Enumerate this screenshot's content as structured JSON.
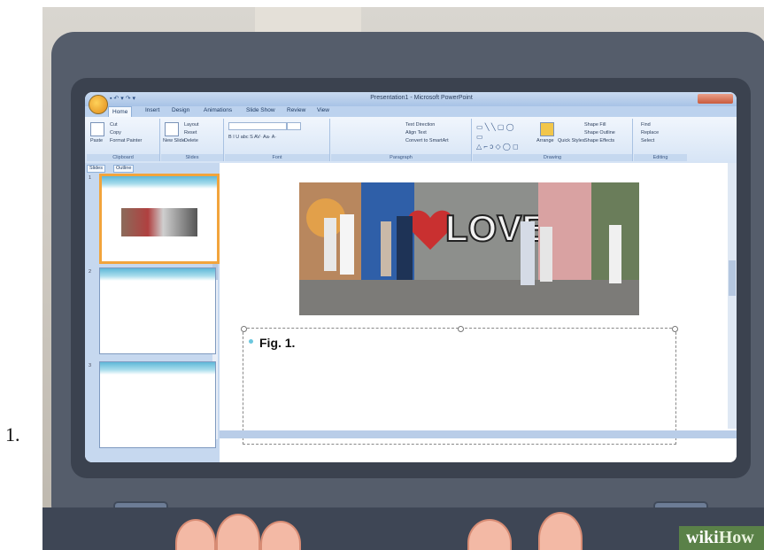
{
  "step": {
    "number": "1."
  },
  "window": {
    "title": "Presentation1 - Microsoft PowerPoint",
    "quick_access": "▪ ↶ ▾ ↷ ▾"
  },
  "ribbon_tabs": [
    "Home",
    "Insert",
    "Design",
    "Animations",
    "Slide Show",
    "Review",
    "View"
  ],
  "ribbon": {
    "clipboard": {
      "paste": "Paste",
      "cut": "Cut",
      "copy": "Copy",
      "format_painter": "Format Painter",
      "label": "Clipboard"
    },
    "slides": {
      "new_slide": "New Slide",
      "layout": "Layout",
      "reset": "Reset",
      "delete": "Delete",
      "label": "Slides"
    },
    "font": {
      "label": "Font",
      "row": "B I U abc S AV· Aa· A·"
    },
    "paragraph": {
      "text_direction": "Text Direction",
      "align_text": "Align Text",
      "smartart": "Convert to SmartArt",
      "label": "Paragraph"
    },
    "drawing": {
      "arrange": "Arrange",
      "quick_styles": "Quick Styles",
      "shape_fill": "Shape Fill",
      "shape_outline": "Shape Outline",
      "shape_effects": "Shape Effects",
      "label": "Drawing"
    },
    "editing": {
      "find": "Find",
      "replace": "Replace",
      "select": "Select",
      "label": "Editing"
    }
  },
  "panel": {
    "tabs": [
      "Slides",
      "Outline"
    ],
    "thumbnails": [
      "1",
      "2",
      "3"
    ]
  },
  "slide": {
    "caption": "Fig. 1."
  },
  "watermark": {
    "part1": "wiki",
    "part2": "How"
  },
  "colors": {
    "accent_selection": "#f2a43c",
    "ribbon_blue": "#d6e4f5",
    "title_blue": "#a8c3e6"
  }
}
